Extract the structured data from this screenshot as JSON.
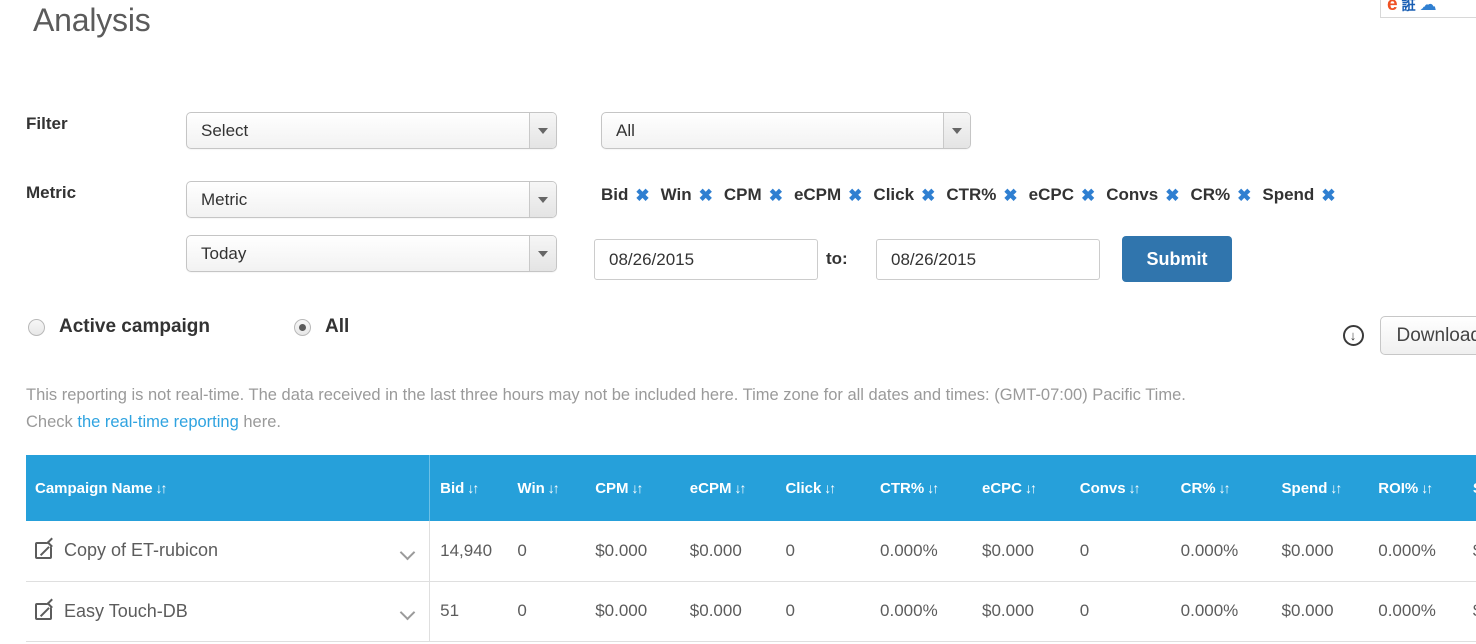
{
  "page_title": "Analysis",
  "extension_icons": [
    "e-logo-icon",
    "translate-icon",
    "cloud-icon"
  ],
  "form": {
    "filter_label": "Filter",
    "metric_label": "Metric",
    "filter_select_value": "Select",
    "scope_select_value": "All",
    "metric_select_value": "Metric",
    "period_select_value": "Today",
    "date_from": "08/26/2015",
    "date_to": "08/26/2015",
    "to_label": "to:",
    "submit_label": "Submit"
  },
  "metric_tags": [
    {
      "label": "Bid",
      "remove": "✖"
    },
    {
      "label": "Win",
      "remove": "✖"
    },
    {
      "label": "CPM",
      "remove": "✖"
    },
    {
      "label": "eCPM",
      "remove": "✖"
    },
    {
      "label": "Click",
      "remove": "✖"
    },
    {
      "label": "CTR%",
      "remove": "✖"
    },
    {
      "label": "eCPC",
      "remove": "✖"
    },
    {
      "label": "Convs",
      "remove": "✖"
    },
    {
      "label": "CR%",
      "remove": "✖"
    },
    {
      "label": "Spend",
      "remove": "✖"
    }
  ],
  "radios": {
    "active_label": "Active campaign",
    "all_label": "All",
    "active_checked": false,
    "all_checked": true
  },
  "download": {
    "icon": "download-circle-icon",
    "label": "Download"
  },
  "notice": {
    "line1": "This reporting is not real-time. The data received in the last three hours may not be included here. Time zone for all dates and times: (GMT-07:00) Pacific Time.",
    "line2_prefix": "Check ",
    "link_text": "the real-time reporting",
    "line2_suffix": " here."
  },
  "table": {
    "sort_icon": "↓↑",
    "columns": [
      "Campaign Name",
      "Bid",
      "Win",
      "CPM",
      "eCPM",
      "Click",
      "CTR%",
      "eCPC",
      "Convs",
      "CR%",
      "Spend",
      "ROI%",
      "S"
    ],
    "rows": [
      {
        "name": "Copy of ET-rubicon",
        "bid": "14,940",
        "win": "0",
        "cpm": "$0.000",
        "ecpm": "$0.000",
        "click": "0",
        "ctr": "0.000%",
        "ecpc": "$0.000",
        "convs": "0",
        "cr": "0.000%",
        "spend": "$0.000",
        "roi": "0.000%",
        "extra": "$"
      },
      {
        "name": "Easy Touch-DB",
        "bid": "51",
        "win": "0",
        "cpm": "$0.000",
        "ecpm": "$0.000",
        "click": "0",
        "ctr": "0.000%",
        "ecpc": "$0.000",
        "convs": "0",
        "cr": "0.000%",
        "spend": "$0.000",
        "roi": "0.000%",
        "extra": "$"
      }
    ]
  },
  "colors": {
    "table_header_blue": "#26a0da",
    "submit_blue": "#3075ad",
    "link_blue": "#2fa3e0",
    "tag_x_blue": "#2f7fd1"
  }
}
